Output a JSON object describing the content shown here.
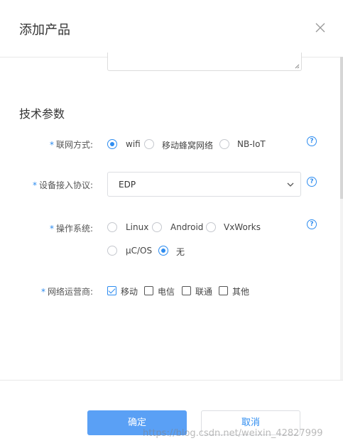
{
  "dialog": {
    "title": "添加产品"
  },
  "section": {
    "tech_params_title": "技术参数"
  },
  "fields": {
    "network_mode": {
      "required_mark": "*",
      "label": "联网方式:",
      "options": [
        "wifi",
        "移动蜂窝网络",
        "NB-IoT"
      ],
      "selected": "wifi"
    },
    "protocol": {
      "required_mark": "*",
      "label": "设备接入协议:",
      "value": "EDP"
    },
    "os": {
      "required_mark": "*",
      "label": "操作系统:",
      "options": [
        "Linux",
        "Android",
        "VxWorks",
        "μC/OS",
        "无"
      ],
      "selected": "无"
    },
    "carrier": {
      "required_mark": "*",
      "label": "网络运营商:",
      "options": [
        "移动",
        "电信",
        "联通",
        "其他"
      ],
      "checked": [
        "移动"
      ]
    }
  },
  "help_icon": "?",
  "buttons": {
    "ok": "确定",
    "cancel": "取消"
  },
  "watermark": "https://blog.csdn.net/weixin_42827999",
  "colors": {
    "accent": "#2d8cf0",
    "ok_button": "#5aa0f5"
  },
  "icons": [
    "close-icon",
    "help-icon",
    "chevron-down-icon",
    "resize-grip-icon"
  ]
}
